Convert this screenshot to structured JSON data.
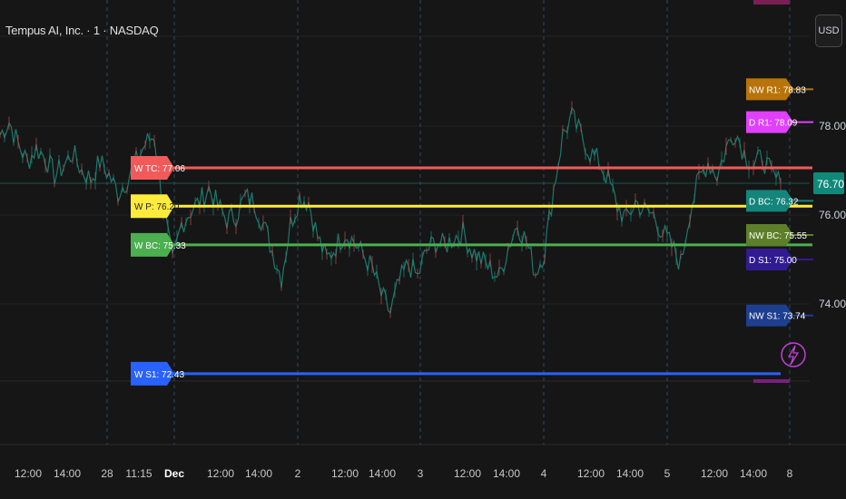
{
  "header": {
    "symbol_title": "Tempus AI, Inc. · 1 · NASDAQ",
    "currency_button": "USD"
  },
  "price_axis": {
    "current_price": "76.70",
    "current_price_color": "#0f8a7a"
  },
  "chart_data": {
    "type": "line",
    "x_tick_labels": [
      "12:00",
      "14:00",
      "28",
      "11:15",
      "Dec",
      "12:00",
      "14:00",
      "2",
      "12:00",
      "14:00",
      "3",
      "12:00",
      "14:00",
      "4",
      "12:00",
      "14:00",
      "5",
      "12:00",
      "14:00",
      "8"
    ],
    "y_tick_labels": [
      "78.00",
      "76.00",
      "74.00"
    ],
    "ylim": [
      71.5,
      80.2
    ],
    "series": [
      {
        "values": [
          77.8,
          78.1,
          77.6,
          77.2,
          77.5,
          77.3,
          76.9,
          77.1,
          77.4,
          77.0,
          76.8,
          77.2,
          76.9,
          76.5,
          76.8,
          77.2,
          77.6,
          77.8,
          76.2,
          74.9,
          75.8,
          76.1,
          76.3,
          76.6,
          76.2,
          75.9,
          76.0,
          76.4,
          76.3,
          75.8,
          75.2,
          74.6,
          75.8,
          76.4,
          76.3,
          75.5,
          75.0,
          75.3,
          75.6,
          75.4,
          75.1,
          74.8,
          74.2,
          73.8,
          74.5,
          74.9,
          74.6,
          75.2,
          75.4,
          75.3,
          75.5,
          75.6,
          75.2,
          75.0,
          74.8,
          74.6,
          75.3,
          75.8,
          75.4,
          74.7,
          75.2,
          76.6,
          77.8,
          78.2,
          77.8,
          77.4,
          77.2,
          76.8,
          76.2,
          75.9,
          76.3,
          76.1,
          76.0,
          75.6,
          75.3,
          74.9,
          76.1,
          76.8,
          77.2,
          76.9,
          77.5,
          77.9,
          77.4,
          77.1,
          77.3,
          76.9,
          76.7
        ]
      }
    ],
    "pivot_levels": [
      {
        "label": "W TC: 77.06",
        "value": 77.06,
        "color": "#f25a5a"
      },
      {
        "label": "W P: 76.20",
        "value": 76.2,
        "color": "#ffeb3b"
      },
      {
        "label": "W BC: 75.33",
        "value": 75.33,
        "color": "#4caf50"
      },
      {
        "label": "W S1: 72.43",
        "value": 72.43,
        "color": "#2962ff"
      }
    ],
    "right_labels": [
      {
        "label": "NW R1: 78.83",
        "value": 78.83,
        "color": "#b8740a"
      },
      {
        "label": "D R1: 78.09",
        "value": 78.09,
        "color": "#e040fb"
      },
      {
        "label": "D BC: 76.32",
        "value": 76.32,
        "color": "#14857a"
      },
      {
        "label": "NW BC: 75.55",
        "value": 75.55,
        "color": "#5d7f2a"
      },
      {
        "label": "D S1: 75.00",
        "value": 75.0,
        "color": "#311b92"
      },
      {
        "label": "NW S1: 73.74",
        "value": 73.74,
        "color": "#1e3f8f"
      }
    ]
  }
}
